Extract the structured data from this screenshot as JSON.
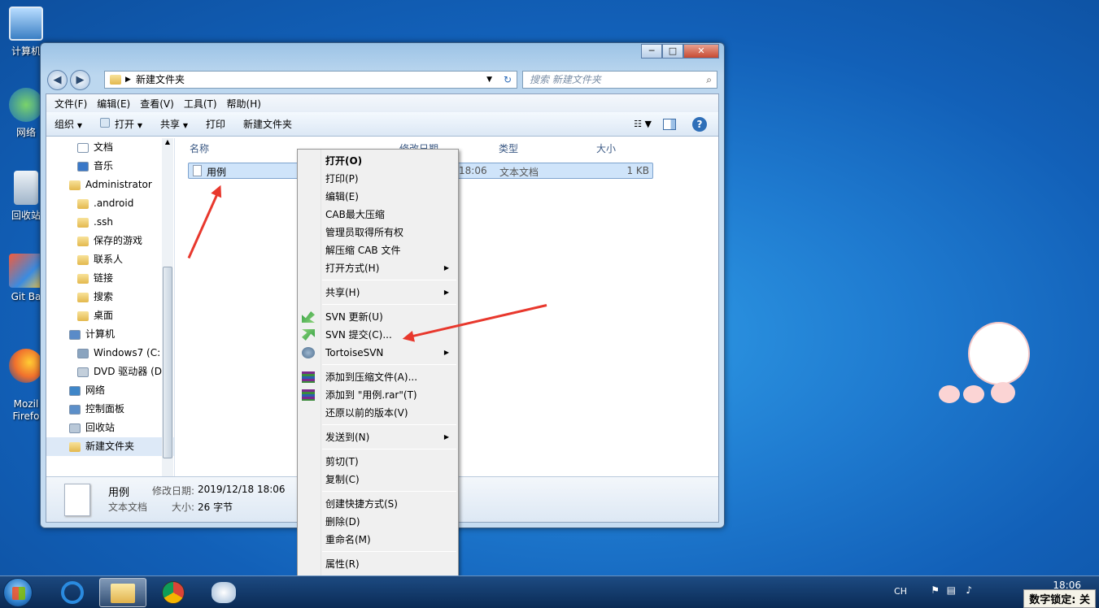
{
  "desktop": {
    "icons": [
      "计算机",
      "网络",
      "回收站",
      "Git Ba",
      "Mozil\nFirefo"
    ]
  },
  "window": {
    "address_path": "新建文件夹",
    "search_placeholder": "搜索 新建文件夹",
    "menu": [
      "文件(F)",
      "编辑(E)",
      "查看(V)",
      "工具(T)",
      "帮助(H)"
    ],
    "toolbar": {
      "organize": "组织",
      "open": "打开",
      "share": "共享",
      "print": "打印",
      "new_folder": "新建文件夹"
    },
    "nav_items": [
      {
        "label": "文档",
        "indent": 1
      },
      {
        "label": "音乐",
        "indent": 1
      },
      {
        "label": "Administrator",
        "indent": 0
      },
      {
        "label": ".android",
        "indent": 1
      },
      {
        "label": ".ssh",
        "indent": 1
      },
      {
        "label": "保存的游戏",
        "indent": 1
      },
      {
        "label": "联系人",
        "indent": 1
      },
      {
        "label": "链接",
        "indent": 1
      },
      {
        "label": "搜索",
        "indent": 1
      },
      {
        "label": "桌面",
        "indent": 1
      },
      {
        "label": "计算机",
        "indent": 0
      },
      {
        "label": "Windows7 (C:",
        "indent": 1
      },
      {
        "label": "DVD 驱动器 (D",
        "indent": 1
      },
      {
        "label": "网络",
        "indent": 0
      },
      {
        "label": "控制面板",
        "indent": 0
      },
      {
        "label": "回收站",
        "indent": 0
      },
      {
        "label": "新建文件夹",
        "indent": 0,
        "selected": true
      }
    ],
    "columns": {
      "name": "名称",
      "modified": "修改日期",
      "type": "类型",
      "size": "大小"
    },
    "file": {
      "name": "用例",
      "modified": "18:06",
      "type": "文本文档",
      "size": "1 KB"
    },
    "details": {
      "name": "用例",
      "type": "文本文档",
      "modified_label": "修改日期:",
      "modified": "2019/12/18 18:06",
      "size_label": "大小:",
      "size": "26 字节"
    }
  },
  "context_menu": {
    "items": [
      {
        "label": "打开(O)",
        "bold": true
      },
      {
        "label": "打印(P)"
      },
      {
        "label": "编辑(E)"
      },
      {
        "label": "CAB最大压缩"
      },
      {
        "label": "管理员取得所有权"
      },
      {
        "label": "解压缩 CAB 文件"
      },
      {
        "label": "打开方式(H)",
        "submenu": true
      },
      {
        "sep": true
      },
      {
        "label": "共享(H)",
        "submenu": true
      },
      {
        "sep": true
      },
      {
        "label": "SVN 更新(U)",
        "icon": "svn-update-icon"
      },
      {
        "label": "SVN 提交(C)...",
        "icon": "svn-commit-icon"
      },
      {
        "label": "TortoiseSVN",
        "submenu": true,
        "icon": "tortoisesvn-icon"
      },
      {
        "sep": true
      },
      {
        "label": "添加到压缩文件(A)...",
        "icon": "winrar-icon"
      },
      {
        "label": "添加到 \"用例.rar\"(T)",
        "icon": "winrar-icon"
      },
      {
        "label": "还原以前的版本(V)"
      },
      {
        "sep": true
      },
      {
        "label": "发送到(N)",
        "submenu": true
      },
      {
        "sep": true
      },
      {
        "label": "剪切(T)"
      },
      {
        "label": "复制(C)"
      },
      {
        "sep": true
      },
      {
        "label": "创建快捷方式(S)"
      },
      {
        "label": "删除(D)"
      },
      {
        "label": "重命名(M)"
      },
      {
        "sep": true
      },
      {
        "label": "属性(R)"
      }
    ]
  },
  "taskbar": {
    "clock": "18:06",
    "ime": "CH",
    "numlock": "数字锁定: 关"
  },
  "colors": {
    "arrow": "#e8382d",
    "selection": "#cfe4fa"
  }
}
